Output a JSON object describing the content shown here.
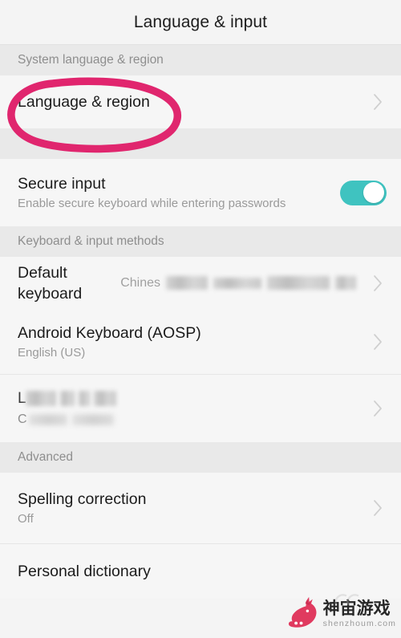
{
  "app": {
    "title": "Language & input"
  },
  "colors": {
    "toggle_on": "#3fc3c0",
    "annotation_pink": "#e0266e",
    "page_bg": "#f4f4f4",
    "row_bg": "#f6f6f6",
    "section_bg": "#e9e9e9",
    "title_text": "#1d1d1d",
    "secondary_text": "#9a9a9a",
    "chevron": "#cfcfcf",
    "watermark_logo": "#e03a5f"
  },
  "sections": [
    {
      "header": "System language & region",
      "rows": [
        {
          "name": "language-and-region",
          "title": "Language & region",
          "subtitle": "",
          "value": "",
          "accessory": "chevron",
          "annotated": true
        }
      ]
    },
    {
      "header": "",
      "rows": [
        {
          "name": "secure-input",
          "title": "Secure input",
          "subtitle": "Enable secure keyboard while entering passwords",
          "value": "",
          "accessory": "toggle",
          "toggle_on": true,
          "annotated": false
        }
      ]
    },
    {
      "header": "Keyboard & input methods",
      "rows": [
        {
          "name": "default-keyboard",
          "title": "Default keyboard",
          "subtitle": "",
          "value": "Chines",
          "value_redacted": true,
          "accessory": "chevron",
          "annotated": false
        },
        {
          "name": "android-keyboard-aosp",
          "title": "Android Keyboard (AOSP)",
          "subtitle": "English (US)",
          "value": "",
          "accessory": "chevron",
          "annotated": false
        },
        {
          "name": "redacted-input-method",
          "title": "L",
          "title_redacted": true,
          "subtitle": "C",
          "subtitle_redacted": true,
          "value": "",
          "accessory": "chevron",
          "annotated": false
        }
      ]
    },
    {
      "header": "Advanced",
      "rows": [
        {
          "name": "spelling-correction",
          "title": "Spelling correction",
          "subtitle": "Off",
          "value": "",
          "accessory": "chevron",
          "annotated": false
        },
        {
          "name": "personal-dictionary",
          "title": "Personal dictionary",
          "subtitle": "",
          "value": "",
          "accessory": "none",
          "annotated": false
        }
      ]
    }
  ],
  "watermark": {
    "cn_text": "神宙游戏",
    "en_text": "shenzhoum.com"
  }
}
